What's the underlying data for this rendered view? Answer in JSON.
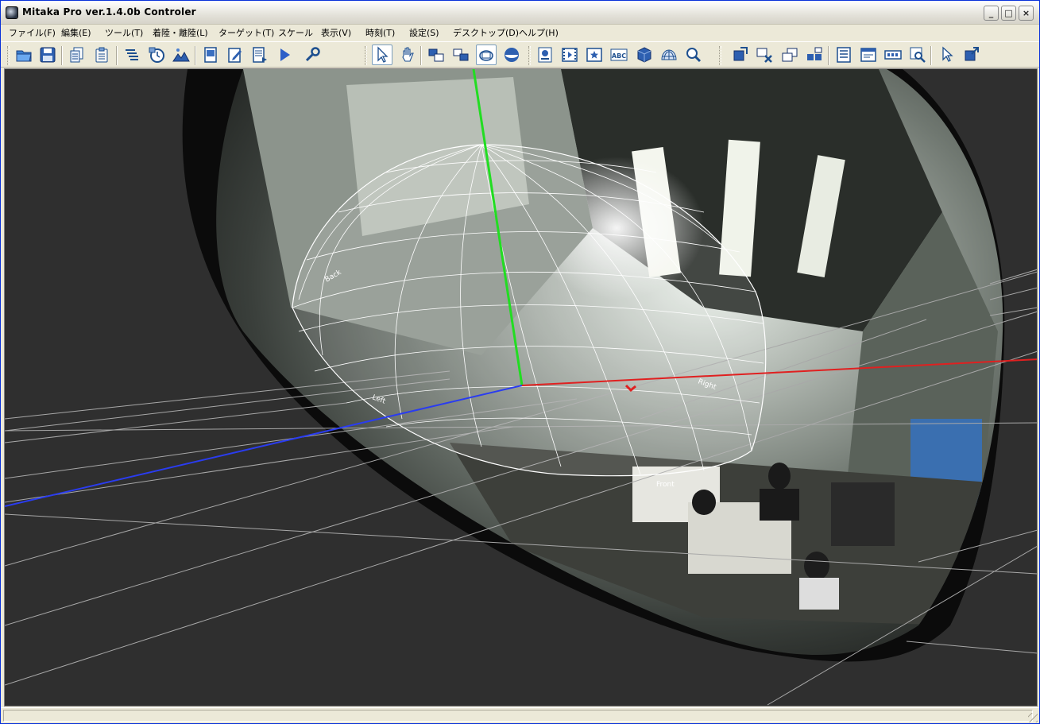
{
  "window": {
    "title": "Mitaka Pro ver.1.4.0b Controler",
    "buttons": {
      "minimize": "_",
      "maximize": "□",
      "close": "×"
    }
  },
  "menu": [
    "ファイル(F)",
    "編集(E)",
    "ツール(T)",
    "着陸・離陸(L)",
    "ターゲット(T)",
    "スケール",
    "表示(V)",
    "時刻(T)",
    "設定(S)",
    "デスクトップ(D)",
    "ヘルプ(H)"
  ],
  "toolbar": {
    "icons": [
      "open-folder-icon",
      "save-disk-icon",
      "copy-document-icon",
      "clipboard-icon",
      "layers-icon",
      "clock-settings-icon",
      "landscape-icon",
      "monitor-settings-icon",
      "edit-pencil-icon",
      "script-document-icon",
      "play-icon",
      "wrench-icon",
      "select-arrow-icon",
      "pan-hand-icon",
      "window-layout-icon",
      "window-split-icon",
      "camera-view-icon",
      "fisheye-sphere-icon",
      "place-marker-icon",
      "film-icon",
      "star-map-icon",
      "text-label-icon",
      "cube-icon",
      "dome-grid-icon",
      "zoom-draw-icon",
      "move-object-icon",
      "delete-object-icon",
      "duplicate-icon",
      "grid-arrange-icon",
      "list-properties-icon",
      "panel-icon",
      "display-format-icon",
      "zoom-search-icon",
      "pointer-icon",
      "link-object-icon"
    ],
    "text_icon_label": "ABC",
    "active": [
      "select-arrow-icon",
      "fisheye-sphere-icon"
    ]
  },
  "viewport": {
    "background": "#2f2f2f",
    "axis_colors": {
      "x": "#e02020",
      "y": "#22dd22",
      "z": "#2a3cf0"
    },
    "dome_labels": {
      "back": "Back",
      "left": "Left",
      "right": "Right",
      "front": "Front"
    }
  },
  "statusbar": {
    "text": ""
  }
}
